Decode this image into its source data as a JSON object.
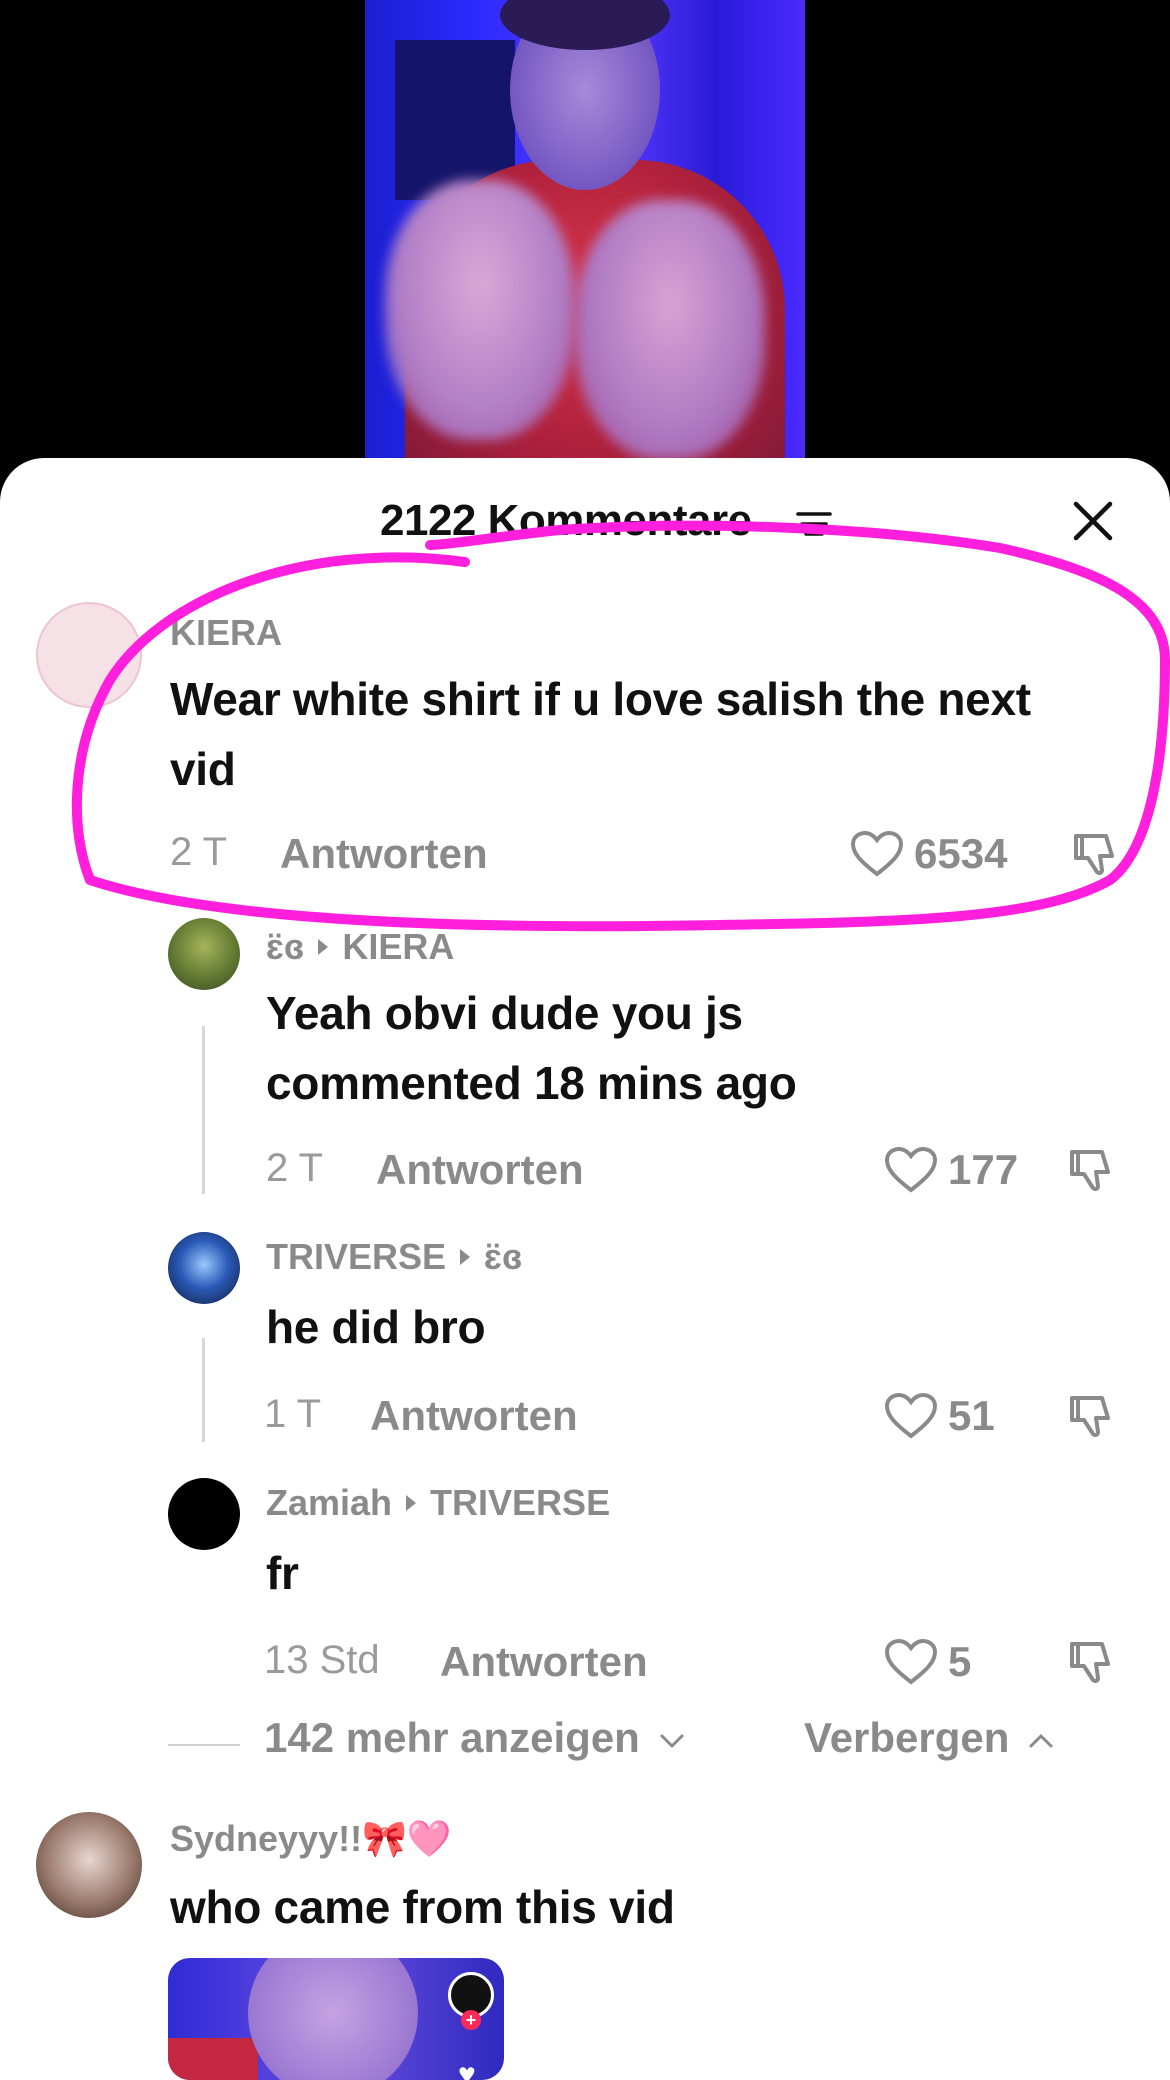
{
  "header": {
    "title": "2122 Kommentare"
  },
  "comments": [
    {
      "username": "KIERA",
      "text": "Wear white shirt if u love salish the next vid",
      "time": "2 T",
      "reply_label": "Antworten",
      "likes": "6534"
    },
    {
      "username": "ɛ̈ɞ",
      "reply_to": "KIERA",
      "text": "Yeah obvi dude you js commented 18 mins ago",
      "time": "2 T",
      "reply_label": "Antworten",
      "likes": "177"
    },
    {
      "username": "TRIVERSE",
      "reply_to": "ɛ̈ɞ",
      "text": "he did bro",
      "time": "1 T",
      "reply_label": "Antworten",
      "likes": "51"
    },
    {
      "username": "Zamiah",
      "reply_to": "TRIVERSE",
      "text": "fr",
      "time": "13 Std",
      "reply_label": "Antworten",
      "likes": "5"
    },
    {
      "username": "Sydneyyy!!🎀🩷",
      "text": "who came from this vid"
    }
  ],
  "thread_controls": {
    "more_label": "142 mehr anzeigen",
    "hide_label": "Verbergen"
  },
  "colors": {
    "annotation": "#ff1fdc",
    "muted_text": "#8a8a8a",
    "main_text": "#111111"
  }
}
